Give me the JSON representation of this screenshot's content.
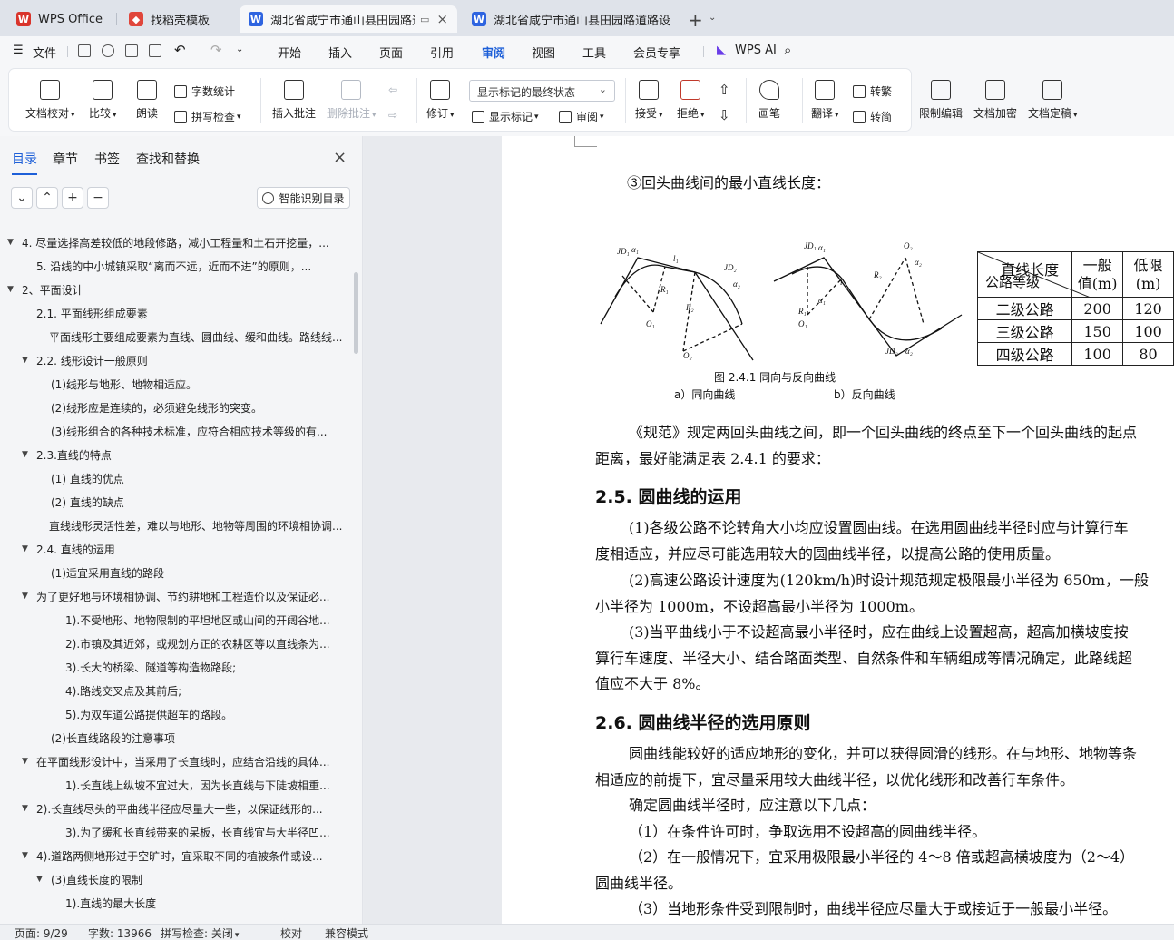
{
  "tabs": [
    {
      "label": "WPS Office",
      "icon": "wps-logo-icon",
      "color": "#d9342b"
    },
    {
      "label": "找稻壳模板",
      "icon": "docer-icon",
      "color": "#e0463b"
    },
    {
      "label": "湖北省咸宁市通山县田园路道",
      "icon": "word-doc-icon",
      "color": "#2e64e0"
    },
    {
      "label": "湖北省咸宁市通山县田园路道路设计（",
      "icon": "word-doc-icon",
      "color": "#2e64e0"
    }
  ],
  "menu": {
    "file": "文件",
    "items": [
      "开始",
      "插入",
      "页面",
      "引用",
      "审阅",
      "视图",
      "工具",
      "会员专享"
    ],
    "active": "审阅",
    "ai": "WPS AI"
  },
  "ribbon": {
    "doc_check": "文档校对",
    "compare": "比较",
    "read_aloud": "朗读",
    "word_count": "字数统计",
    "spell_check": "拼写检查",
    "insert_comment": "插入批注",
    "delete_comment": "删除批注",
    "revise": "修订",
    "markup_state": "显示标记的最终状态",
    "show_markup": "显示标记",
    "review": "审阅",
    "accept": "接受",
    "reject": "拒绝",
    "pen": "画笔",
    "translate": "翻译",
    "to_traditional": "转繁",
    "to_simplified": "转简",
    "restrict_edit": "限制编辑",
    "encrypt": "文档加密",
    "finalize": "文档定稿"
  },
  "sidebar": {
    "tabs": [
      "目录",
      "章节",
      "书签",
      "查找和替换"
    ],
    "active_tab": "目录",
    "smart_toc": "智能识别目录",
    "toc": [
      {
        "level": 1,
        "arrow": "▼",
        "text": "4. 尽量选择高差较低的地段修路，减小工程量和土石开挖量，..."
      },
      {
        "level": 2,
        "arrow": "",
        "text": "5. 沿线的中小城镇采取“离而不远，近而不进”的原则，..."
      },
      {
        "level": 1,
        "arrow": "▼",
        "text": "2、平面设计"
      },
      {
        "level": 2,
        "arrow": "",
        "text": "2.1. 平面线形组成要素"
      },
      {
        "level": 1.5,
        "arrow": "",
        "text": "平面线形主要组成要素为直线、圆曲线、缓和曲线。路线线..."
      },
      {
        "level": 2,
        "arrow": "▼",
        "text": "2.2. 线形设计一般原则"
      },
      {
        "level": 3,
        "arrow": "",
        "text": "(1)线形与地形、地物相适应。"
      },
      {
        "level": 3,
        "arrow": "",
        "text": "(2)线形应是连续的，必须避免线形的突变。"
      },
      {
        "level": 3,
        "arrow": "",
        "text": "(3)线形组合的各种技术标准，应符合相应技术等级的有..."
      },
      {
        "level": 2,
        "arrow": "▼",
        "text": "2.3.直线的特点"
      },
      {
        "level": 3,
        "arrow": "",
        "text": "(1) 直线的优点"
      },
      {
        "level": 3,
        "arrow": "",
        "text": "(2) 直线的缺点"
      },
      {
        "level": 1.5,
        "arrow": "",
        "text": "直线线形灵活性差，难以与地形、地物等周围的环境相协调..."
      },
      {
        "level": 2,
        "arrow": "▼",
        "text": "2.4. 直线的运用"
      },
      {
        "level": 3,
        "arrow": "",
        "text": "(1)适宜采用直线的路段"
      },
      {
        "level": 2,
        "arrow": "▼",
        "text": "为了更好地与环境相协调、节约耕地和工程造价以及保证必..."
      },
      {
        "level": 4,
        "arrow": "",
        "text": "1).不受地形、地物限制的平坦地区或山间的开阔谷地..."
      },
      {
        "level": 4,
        "arrow": "",
        "text": "2).市镇及其近郊，或规划方正的农耕区等以直线条为..."
      },
      {
        "level": 4,
        "arrow": "",
        "text": "3).长大的桥梁、隧道等构造物路段;"
      },
      {
        "level": 4,
        "arrow": "",
        "text": "4).路线交叉点及其前后;"
      },
      {
        "level": 4,
        "arrow": "",
        "text": "5).为双车道公路提供超车的路段。"
      },
      {
        "level": 3,
        "arrow": "",
        "text": "(2)长直线路段的注意事项"
      },
      {
        "level": 2,
        "arrow": "▼",
        "text": "在平面线形设计中，当采用了长直线时，应结合沿线的具体..."
      },
      {
        "level": 4,
        "arrow": "",
        "text": "1).长直线上纵坡不宜过大，因为长直线与下陡坡相重..."
      },
      {
        "level": 2,
        "arrow": "▼",
        "text": "2).长直线尽头的平曲线半径应尽量大一些，以保证线形的..."
      },
      {
        "level": 4,
        "arrow": "",
        "text": "3).为了缓和长直线带来的呆板，长直线宜与大半径凹..."
      },
      {
        "level": 2,
        "arrow": "▼",
        "text": "4).道路两侧地形过于空旷时，宜采取不同的植被条件或设..."
      },
      {
        "level": 3,
        "arrow": "▼",
        "text": "(3)直线长度的限制"
      },
      {
        "level": 4,
        "arrow": "",
        "text": "1).直线的最大长度"
      }
    ]
  },
  "document": {
    "heading_hairpin": "③回头曲线间的最小直线长度：",
    "figure": {
      "caption": "图 2.4.1    同向与反向曲线",
      "sub_a": "a）同向曲线",
      "sub_b": "b）反向曲线",
      "labels": [
        "JD₁",
        "α₁",
        "l₁",
        "JD₂",
        "α₂",
        "R₁",
        "R₂",
        "O₁",
        "O₂",
        "JD₁",
        "α₁",
        "O₂",
        "α₂",
        "l",
        "R₂",
        "R₁",
        "O₁",
        "JD₂",
        "α₂",
        "α₁"
      ]
    },
    "table": {
      "header_diag_top": "直线长度",
      "header_diag_bottom": "公路等级",
      "col1": "一般值(m)",
      "col1_line1": "一般",
      "col1_line2": "值(m)",
      "col2_line1": "低限",
      "col2_line2": "(m)",
      "rows": [
        {
          "grade": "二级公路",
          "general": "200",
          "min": "120"
        },
        {
          "grade": "三级公路",
          "general": "150",
          "min": "100"
        },
        {
          "grade": "四级公路",
          "general": "100",
          "min": "80"
        }
      ]
    },
    "para1_line1": "《规范》规定两回头曲线之间，即一个回头曲线的终点至下一个回头曲线的起点",
    "para1_line2": "距离，最好能满足表 2.4.1 的要求：",
    "h25": "2.5. 圆曲线的运用",
    "p25_1a": "(1)各级公路不论转角大小均应设置圆曲线。在选用圆曲线半径时应与计算行车",
    "p25_1b": "度相适应，并应尽可能选用较大的圆曲线半径，以提高公路的使用质量。",
    "p25_2a": "(2)高速公路设计速度为(120km/h)时设计规范规定极限最小半径为 650m，一般",
    "p25_2b": "小半径为 1000m，不设超高最小半径为 1000m。",
    "p25_3a": "(3)当平曲线小于不设超高最小半径时，应在曲线上设置超高，超高加横坡度按",
    "p25_3b": "算行车速度、半径大小、结合路面类型、自然条件和车辆组成等情况确定，此路线超",
    "p25_3c": "值应不大于 8%。",
    "h26": "2.6. 圆曲线半径的选用原则",
    "p26_1a": "圆曲线能较好的适应地形的变化，并可以获得圆滑的线形。在与地形、地物等条",
    "p26_1b": "相适应的前提下，宜尽量采用较大曲线半径，以优化线形和改善行车条件。",
    "p26_2": "确定圆曲线半径时，应注意以下几点：",
    "p26_3": "（1）在条件许可时，争取选用不设超高的圆曲线半径。",
    "p26_4a": "（2）在一般情况下，宜采用极限最小半径的 4～8 倍或超高横坡度为（2～4）",
    "p26_4b": "圆曲线半径。",
    "p26_5": "（3）当地形条件受到限制时，曲线半径应尽量大于或接近于一般最小半径。"
  },
  "statusbar": {
    "page": "页面: 9/29",
    "words": "字数: 13966",
    "spell": "拼写检查: 关闭",
    "proof": "校对",
    "compat": "兼容模式"
  },
  "colors": {
    "accent": "#1d5fd8",
    "word_blue": "#2e64e0",
    "wps_red": "#d9342b"
  }
}
